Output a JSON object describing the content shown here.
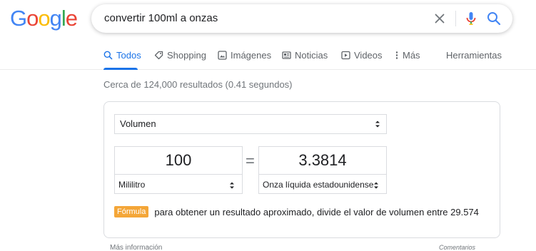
{
  "logo": {
    "letters": [
      "G",
      "o",
      "o",
      "g",
      "l",
      "e"
    ],
    "colors": [
      "#4285f4",
      "#ea4335",
      "#fbbc05",
      "#4285f4",
      "#34a853",
      "#ea4335"
    ]
  },
  "search": {
    "query": "convertir 100ml a onzas"
  },
  "tabs": [
    {
      "label": "Todos",
      "icon": "search-icon",
      "active": true
    },
    {
      "label": "Shopping",
      "icon": "tag-icon"
    },
    {
      "label": "Imágenes",
      "icon": "image-icon"
    },
    {
      "label": "Noticias",
      "icon": "news-icon"
    },
    {
      "label": "Videos",
      "icon": "play-icon"
    },
    {
      "label": "Más",
      "icon": "more-vert-icon"
    }
  ],
  "tools_label": "Herramientas",
  "stats": "Cerca de 124,000 resultados (0.41 segundos)",
  "converter": {
    "category": "Volumen",
    "from_value": "100",
    "from_unit": "Mililitro",
    "equals": "=",
    "to_value": "3.3814",
    "to_unit": "Onza líquida estadounidense",
    "formula_badge": "Fórmula",
    "formula_text": "para obtener un resultado aproximado, divide el valor de volumen entre 29.574"
  },
  "footer": {
    "more_info": "Más información",
    "feedback": "Comentarios"
  },
  "colors": {
    "accent": "#1a73e8",
    "badge": "#f4a638"
  }
}
